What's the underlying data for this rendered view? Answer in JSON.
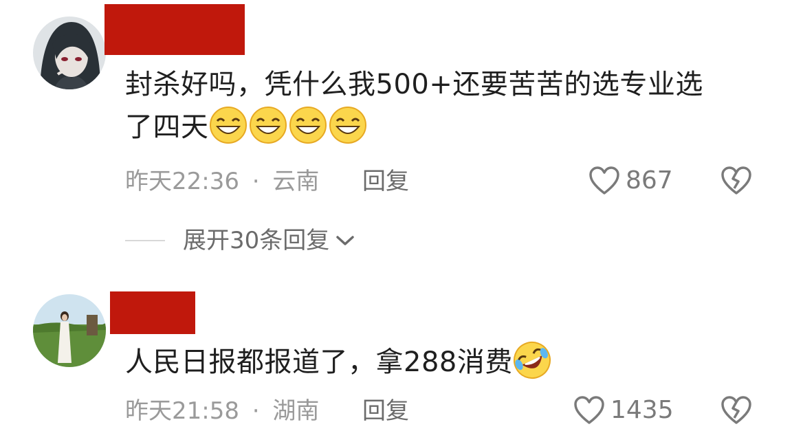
{
  "comments": [
    {
      "text_line1": "封杀好吗，凭什么我500+还要苦苦的选专业选",
      "text_line2": "了四天",
      "emoji": [
        "grin-emoji",
        "grin-emoji",
        "grin-emoji",
        "grin-emoji"
      ],
      "time": "昨天22:36",
      "separator": "·",
      "location": "云南",
      "reply_label": "回复",
      "likes": "867",
      "expand_label": "展开30条回复",
      "redact_color": "#c0180c"
    },
    {
      "text": "人民日报都报道了，拿288消费",
      "emoji": [
        "rofl-emoji"
      ],
      "time": "昨天21:58",
      "separator": "·",
      "location": "湖南",
      "reply_label": "回复",
      "likes": "1435",
      "redact_color": "#c0180c"
    }
  ],
  "colors": {
    "text": "#1f1f1f",
    "meta": "#9a9a9a",
    "action": "#6b6b6b"
  }
}
